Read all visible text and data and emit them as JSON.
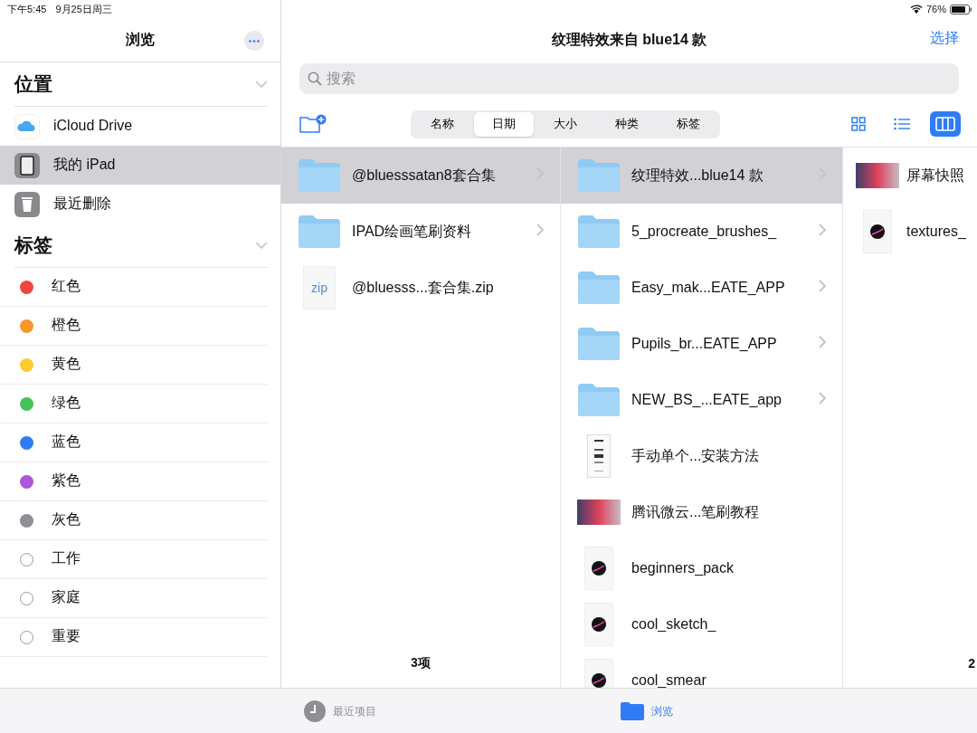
{
  "status_bar": {
    "time": "下午5:45",
    "date": "9月25日周三",
    "battery": "76%"
  },
  "sidebar": {
    "title": "浏览",
    "sections": [
      {
        "title": "位置",
        "expanded": true,
        "items": [
          {
            "label": "iCloud Drive",
            "kind": "cloud",
            "selected": false
          },
          {
            "label": "我的 iPad",
            "kind": "ipad",
            "selected": true
          },
          {
            "label": "最近删除",
            "kind": "trash",
            "selected": false
          }
        ]
      },
      {
        "title": "标签",
        "expanded": true,
        "items": [
          {
            "label": "红色",
            "kind": "tag",
            "color": "#f2453d",
            "selected": false
          },
          {
            "label": "橙色",
            "kind": "tag",
            "color": "#f7962f",
            "selected": false
          },
          {
            "label": "黄色",
            "kind": "tag",
            "color": "#fccb2e",
            "selected": false
          },
          {
            "label": "绿色",
            "kind": "tag",
            "color": "#45c35a",
            "selected": false
          },
          {
            "label": "蓝色",
            "kind": "tag",
            "color": "#2f7cf6",
            "selected": false
          },
          {
            "label": "紫色",
            "kind": "tag",
            "color": "#ad56da",
            "selected": false
          },
          {
            "label": "灰色",
            "kind": "tag",
            "color": "#8e8e93",
            "selected": false
          },
          {
            "label": "工作",
            "kind": "tag",
            "selected": false
          },
          {
            "label": "家庭",
            "kind": "tag",
            "selected": false
          },
          {
            "label": "重要",
            "kind": "tag",
            "selected": false
          }
        ]
      }
    ]
  },
  "main": {
    "title": "纹理特效来自 blue14 款",
    "select_button": "选择",
    "search": {
      "placeholder": "搜索"
    },
    "sort_options": [
      {
        "label": "名称",
        "selected": false
      },
      {
        "label": "日期",
        "selected": true
      },
      {
        "label": "大小",
        "selected": false
      },
      {
        "label": "种类",
        "selected": false
      },
      {
        "label": "标签",
        "selected": false
      }
    ],
    "view_modes": [
      {
        "kind": "grid",
        "selected": false
      },
      {
        "kind": "list",
        "selected": false
      },
      {
        "kind": "columns",
        "selected": true
      }
    ],
    "columns": [
      {
        "footer": "3项",
        "items": [
          {
            "name": "@bluesssatan8套合集",
            "kind": "folder",
            "selected": true
          },
          {
            "name": "IPAD绘画笔刷资料",
            "kind": "folder",
            "selected": false
          },
          {
            "name": "@bluesss...套合集.zip",
            "kind": "zip",
            "icon_text": "zip",
            "selected": false
          }
        ]
      },
      {
        "items": [
          {
            "name": "纹理特效...blue14 款",
            "kind": "folder",
            "selected": true
          },
          {
            "name": "5_procreate_brushes_",
            "kind": "folder",
            "selected": false
          },
          {
            "name": "Easy_mak...EATE_APP",
            "kind": "folder",
            "selected": false
          },
          {
            "name": "Pupils_br...EATE_APP",
            "kind": "folder",
            "selected": false
          },
          {
            "name": "NEW_BS_...EATE_app",
            "kind": "folder",
            "selected": false
          },
          {
            "name": "手动单个...安装方法",
            "kind": "document",
            "selected": false
          },
          {
            "name": "腾讯微云...笔刷教程",
            "kind": "image",
            "selected": false
          },
          {
            "name": "beginners_pack",
            "kind": "brush",
            "selected": false
          },
          {
            "name": "cool_sketch_",
            "kind": "brush",
            "selected": false
          },
          {
            "name": "cool_smear",
            "kind": "brush",
            "selected": false
          }
        ]
      },
      {
        "footer": "2",
        "items": [
          {
            "name": "屏幕快照",
            "kind": "image",
            "selected": false
          },
          {
            "name": "textures_",
            "kind": "brush",
            "selected": false
          }
        ]
      }
    ]
  },
  "tab_bar": [
    {
      "label": "最近项目",
      "kind": "recent",
      "selected": false
    },
    {
      "label": "浏览",
      "kind": "browse",
      "selected": true
    }
  ]
}
